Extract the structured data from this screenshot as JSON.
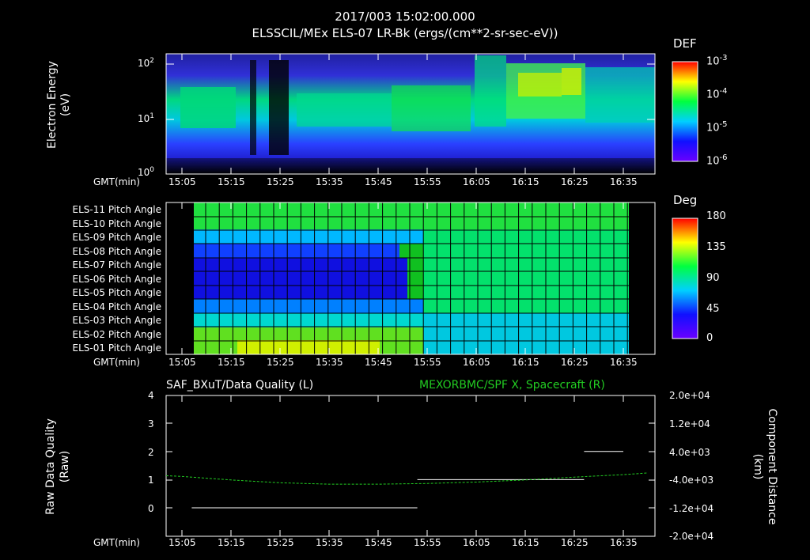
{
  "header": {
    "line1": "2017/003 15:02:00.000",
    "line2": "ELSSCIL/MEx ELS-07 LR-Bk  (ergs/(cm**2-sr-sec-eV))"
  },
  "panel1": {
    "ylabel": "Electron Energy",
    "yunit": "(eV)",
    "yticks": [
      "10",
      "10",
      "10"
    ],
    "yexp": [
      "2",
      "1",
      "0"
    ],
    "colorbar_title": "DEF",
    "colorbar_ticks": [
      "10",
      "10",
      "10",
      "10"
    ],
    "colorbar_exp": [
      "-3",
      "-4",
      "-5",
      "-6"
    ]
  },
  "panel2": {
    "rows": [
      "ELS-11 Pitch Angle",
      "ELS-10 Pitch Angle",
      "ELS-09 Pitch Angle",
      "ELS-08 Pitch Angle",
      "ELS-07 Pitch Angle",
      "ELS-06 Pitch Angle",
      "ELS-05 Pitch Angle",
      "ELS-04 Pitch Angle",
      "ELS-03 Pitch Angle",
      "ELS-02 Pitch Angle",
      "ELS-01 Pitch Angle"
    ],
    "colorbar_title": "Deg",
    "colorbar_ticks": [
      "180",
      "135",
      "90",
      "45",
      "0"
    ]
  },
  "panel3": {
    "title_left": "SAF_BXuT/Data Quality (L)",
    "title_right": "MEXORBMC/SPF X, Spacecraft (R)",
    "ylabel": "Raw Data Quality",
    "yunit": "(Raw)",
    "yticks_left": [
      "4",
      "3",
      "2",
      "1",
      "0"
    ],
    "ylabel_right": "Component Distance",
    "yunit_right": "(km)",
    "yticks_right": [
      "2.0e+04",
      "1.2e+04",
      "4.0e+03",
      "-4.0e+03",
      "-1.2e+04",
      "-2.0e+04"
    ]
  },
  "time_axis": {
    "label": "GMT(min)",
    "ticks": [
      "15:05",
      "15:15",
      "15:25",
      "15:35",
      "15:45",
      "15:55",
      "16:05",
      "16:15",
      "16:25",
      "16:35"
    ]
  },
  "colors": {
    "background": "#000000",
    "foreground": "#ffffff",
    "right_series": "#22cc22"
  },
  "chart_data": [
    {
      "type": "heatmap",
      "title": "ELSSCIL/MEx ELS-07 LR-Bk  (ergs/(cm**2-sr-sec-eV))",
      "ylabel": "Electron Energy (eV)",
      "yscale": "log",
      "ylim": [
        1,
        150
      ],
      "colorbar": "DEF",
      "clim": [
        1e-06,
        0.001
      ],
      "x": [
        "15:05",
        "15:15",
        "15:25",
        "15:35",
        "15:45",
        "15:55",
        "16:05",
        "16:15",
        "16:25",
        "16:35"
      ]
    },
    {
      "type": "heatmap",
      "colorbar": "Deg",
      "clim": [
        0,
        180
      ],
      "rows": [
        "ELS-11",
        "ELS-10",
        "ELS-09",
        "ELS-08",
        "ELS-07",
        "ELS-06",
        "ELS-05",
        "ELS-04",
        "ELS-03",
        "ELS-02",
        "ELS-01"
      ]
    },
    {
      "type": "line",
      "title_left": "SAF_BXuT/Data Quality (L)",
      "title_right": "MEXORBMC/SPF X, Spacecraft (R)",
      "x": [
        "15:05",
        "15:15",
        "15:25",
        "15:35",
        "15:45",
        "15:55",
        "16:05",
        "16:15",
        "16:25",
        "16:35"
      ],
      "ylim_left": [
        0,
        4
      ],
      "ylim_right": [
        -20000,
        20000
      ],
      "series": [
        {
          "name": "SAF_BXuT/Data Quality (L)",
          "segments": [
            {
              "start": "15:07",
              "end": "15:53",
              "value": 0
            },
            {
              "start": "15:53",
              "end": "16:27",
              "value": 1
            },
            {
              "start": "16:27",
              "end": "16:35",
              "value": 2
            }
          ]
        },
        {
          "name": "MEXORBMC/SPF X, Spacecraft (R)",
          "x": [
            "15:05",
            "15:15",
            "15:25",
            "15:35",
            "15:45",
            "15:55",
            "16:05",
            "16:15",
            "16:25",
            "16:35",
            "16:40"
          ],
          "values": [
            -3000,
            -4000,
            -4800,
            -5200,
            -5200,
            -5000,
            -4600,
            -4000,
            -3200,
            -2500,
            -2000
          ]
        }
      ]
    }
  ]
}
